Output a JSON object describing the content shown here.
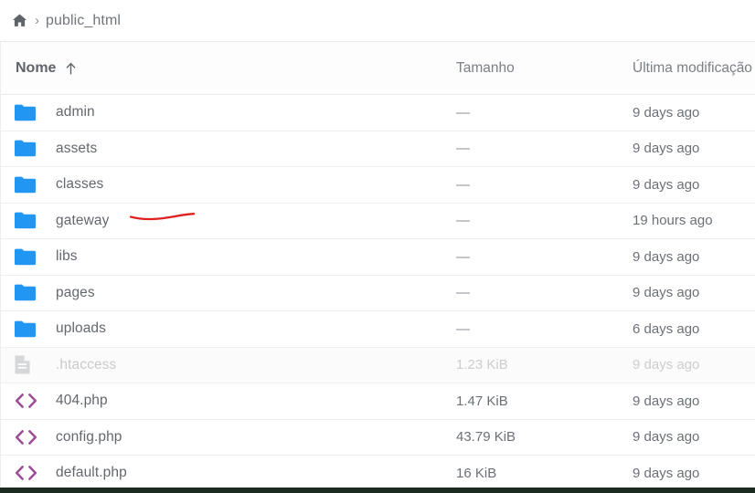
{
  "breadcrumb": {
    "home_icon": "home-icon",
    "separator": "›",
    "current": "public_html"
  },
  "table": {
    "columns": {
      "name": "Nome",
      "size": "Tamanho",
      "modified": "Última modificação"
    },
    "sort": {
      "column": "Nome",
      "direction": "ascending",
      "icon": "arrow-up-icon"
    },
    "rows": [
      {
        "icon": "folder-icon",
        "name": "admin",
        "size": "—",
        "modified": "9 days ago",
        "type": "folder",
        "dimmed": false
      },
      {
        "icon": "folder-icon",
        "name": "assets",
        "size": "—",
        "modified": "9 days ago",
        "type": "folder",
        "dimmed": false
      },
      {
        "icon": "folder-icon",
        "name": "classes",
        "size": "—",
        "modified": "9 days ago",
        "type": "folder",
        "dimmed": false
      },
      {
        "icon": "folder-icon",
        "name": "gateway",
        "size": "—",
        "modified": "19 hours ago",
        "type": "folder",
        "dimmed": false
      },
      {
        "icon": "folder-icon",
        "name": "libs",
        "size": "—",
        "modified": "9 days ago",
        "type": "folder",
        "dimmed": false
      },
      {
        "icon": "folder-icon",
        "name": "pages",
        "size": "—",
        "modified": "9 days ago",
        "type": "folder",
        "dimmed": false
      },
      {
        "icon": "folder-icon",
        "name": "uploads",
        "size": "—",
        "modified": "6 days ago",
        "type": "folder",
        "dimmed": false
      },
      {
        "icon": "document-icon",
        "name": ".htaccess",
        "size": "1.23 KiB",
        "modified": "9 days ago",
        "type": "file",
        "dimmed": true
      },
      {
        "icon": "code-file-icon",
        "name": "404.php",
        "size": "1.47 KiB",
        "modified": "9 days ago",
        "type": "file",
        "dimmed": false
      },
      {
        "icon": "code-file-icon",
        "name": "config.php",
        "size": "43.79 KiB",
        "modified": "9 days ago",
        "type": "file",
        "dimmed": false
      },
      {
        "icon": "code-file-icon",
        "name": "default.php",
        "size": "16 KiB",
        "modified": "9 days ago",
        "type": "file",
        "dimmed": false
      }
    ]
  },
  "annotation": {
    "name": "red-underline-mark",
    "target_row": "gateway",
    "color": "#e02020"
  },
  "colors": {
    "folder": "#2196f3",
    "code_icon": "#9c4f96",
    "document_icon": "#d5d7d8",
    "text": "#63686f",
    "annotation": "#e02020",
    "bottom_bar": "#1b2b1f"
  }
}
